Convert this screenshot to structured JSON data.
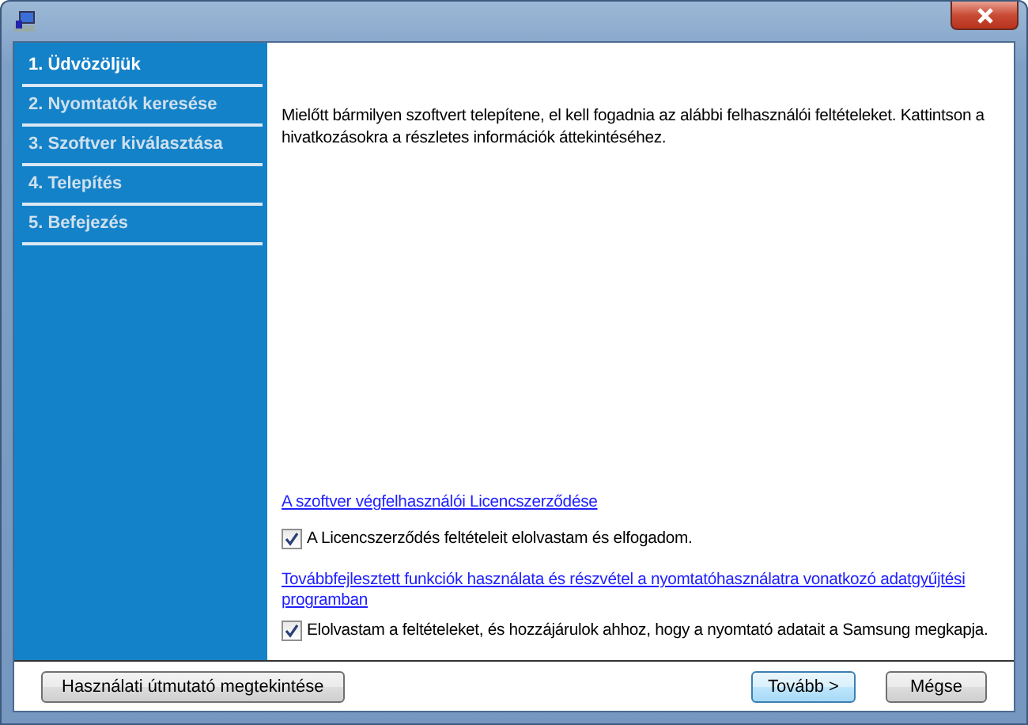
{
  "sidebar": {
    "items": [
      {
        "label": "1. Üdvözöljük",
        "selected": true
      },
      {
        "label": "2. Nyomtatók keresése",
        "selected": false
      },
      {
        "label": "3. Szoftver kiválasztása",
        "selected": false
      },
      {
        "label": "4. Telepítés",
        "selected": false
      },
      {
        "label": "5. Befejezés",
        "selected": false
      }
    ]
  },
  "intro": "Mielőtt bármilyen szoftvert telepítene, el kell fogadnia az alábbi felhasználói feltételeket. Kattintson a hivatkozásokra a részletes információk áttekintéséhez.",
  "agreements": [
    {
      "link": "A szoftver végfelhasználói Licencszerződése",
      "checkbox": "A Licencszerződés feltételeit elolvastam és elfogadom.",
      "checked": true
    },
    {
      "link": "Továbbfejlesztett funkciók használata és részvétel a nyomtatóhasználatra vonatkozó adatgyűjtési programban",
      "checkbox": "Elolvastam a feltételeket, és hozzájárulok ahhoz, hogy a nyomtató adatait a Samsung megkapja.",
      "checked": true
    }
  ],
  "buttons": {
    "guide": "Használati útmutató megtekintése",
    "next": "Tovább >",
    "cancel": "Mégse"
  }
}
